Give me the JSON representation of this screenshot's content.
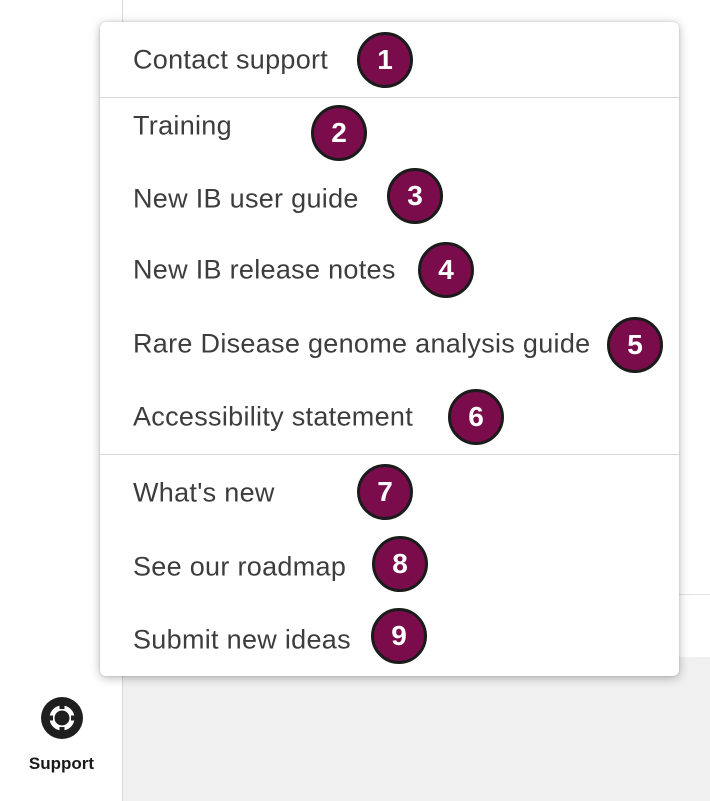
{
  "nav": {
    "support_label": "Support",
    "support_icon": "lifebuoy-icon"
  },
  "menu": {
    "items": [
      {
        "label": "Contact support",
        "badge": "1"
      },
      {
        "label": "Training",
        "badge": "2"
      },
      {
        "label": "New IB user guide",
        "badge": "3"
      },
      {
        "label": "New IB release notes",
        "badge": "4"
      },
      {
        "label": "Rare Disease genome analysis guide",
        "badge": "5"
      },
      {
        "label": "Accessibility statement",
        "badge": "6"
      },
      {
        "label": "What's new",
        "badge": "7"
      },
      {
        "label": "See our roadmap",
        "badge": "8"
      },
      {
        "label": "Submit new ideas",
        "badge": "9"
      }
    ]
  },
  "colors": {
    "badge": "#7a0c4b",
    "text": "#3d3d3d",
    "divider": "#d6d6d6"
  }
}
